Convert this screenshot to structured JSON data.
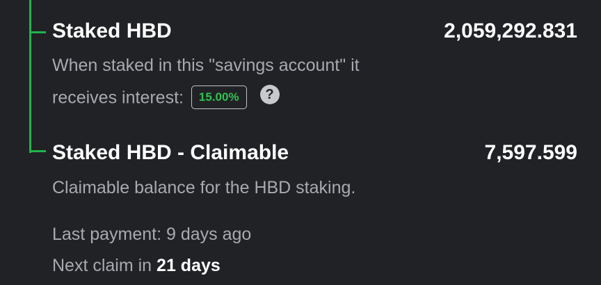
{
  "staked": {
    "title": "Staked HBD",
    "amount": "2,059,292.831",
    "desc_line1": "When staked in this \"savings account\" it",
    "desc_line2_prefix": "receives interest:",
    "interest_rate": "15.00%",
    "help_icon": "?"
  },
  "claimable": {
    "title": "Staked HBD - Claimable",
    "amount": "7,597.599",
    "desc": "Claimable balance for the HBD staking."
  },
  "payment": {
    "last_payment": "Last payment: 9 days ago",
    "next_claim_prefix": "Next claim in",
    "next_claim_value": "21 days"
  },
  "colors": {
    "background": "#212226",
    "accent_green": "#1fb54a",
    "muted_text": "#a9aaaf"
  }
}
